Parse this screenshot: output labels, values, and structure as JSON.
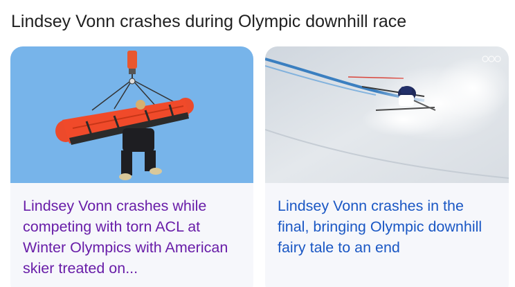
{
  "section": {
    "title": "Lindsey Vonn crashes during Olympic downhill race"
  },
  "cards": [
    {
      "image_icon": "helicopter-rescue-stretcher-photo",
      "headline": "Lindsey Vonn crashes while competing with torn ACL at Winter Olympics with American skier treated on...",
      "visited": true
    },
    {
      "image_icon": "skier-crash-in-snow-photo",
      "headline": "Lindsey Vonn crashes in the final, bringing Olympic downhill fairy tale to an end",
      "visited": false
    }
  ],
  "colors": {
    "title": "#1f1f1f",
    "visited_link": "#681da8",
    "link": "#1a57c4",
    "card_bg": "#f6f7fb",
    "sky": "#77b4ea",
    "stretcher": "#f04a2a"
  }
}
